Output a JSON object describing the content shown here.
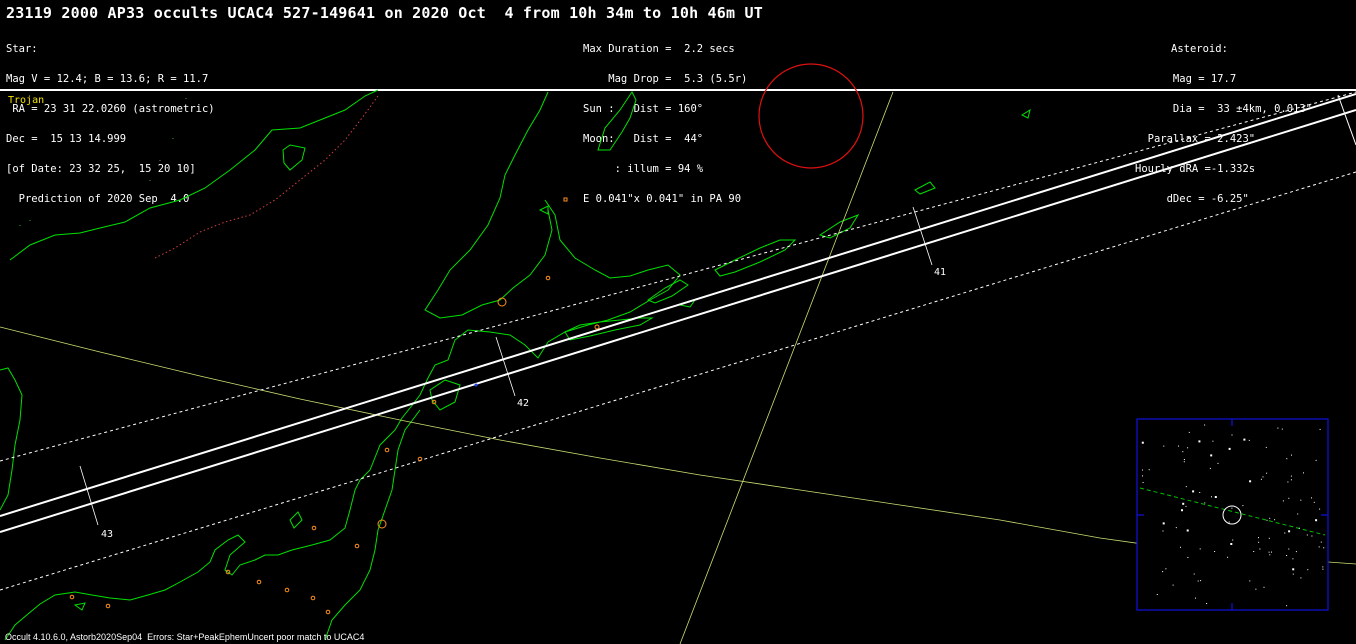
{
  "header": {
    "title": "23119 2000 AP33 occults UCAC4 527-149641 on 2020 Oct  4 from 10h 34m to 10h 46m UT"
  },
  "star": {
    "heading": "Star:",
    "mag": "Mag V = 12.4; B = 13.6; R = 11.7",
    "ra": " RA = 23 31 22.0260 (astrometric)",
    "dec": "Dec =  15 13 14.999",
    "of_date": "[of Date: 23 32 25,  15 20 10]",
    "prediction": "  Prediction of 2020 Sep  4.0"
  },
  "event": {
    "max_duration": "Max Duration =  2.2 secs",
    "mag_drop": "    Mag Drop =  5.3 (5.5r)",
    "sun": "Sun :   Dist = 160°",
    "moon": "Moon:   Dist =  44°",
    "illum": "     : illum = 94 %",
    "ellipse": "E 0.041\"x 0.041\" in PA 90"
  },
  "asteroid": {
    "heading": "Asteroid:",
    "mag": "      Mag = 17.7",
    "dia": "      Dia =  33 ±4km, 0.013\"",
    "parallax": "  Parallax = 2.423\"",
    "hourly_dra": "Hourly dRA =-1.332s",
    "ddec": "     dDec = -6.25\""
  },
  "class_label": "Trojan",
  "time_labels": [
    "41",
    "42",
    "43"
  ],
  "footer": "Occult 4.10.6.0, Astorb2020Sep04  Errors: Star+PeakEphemUncert poor match to UCAC4",
  "colors": {
    "coast": "#00e000",
    "border": "#d04040",
    "path": "#ffffff",
    "track": "#c8e070",
    "moon": "#e01010",
    "finder": "#1010e0",
    "city": "#ff9020"
  }
}
